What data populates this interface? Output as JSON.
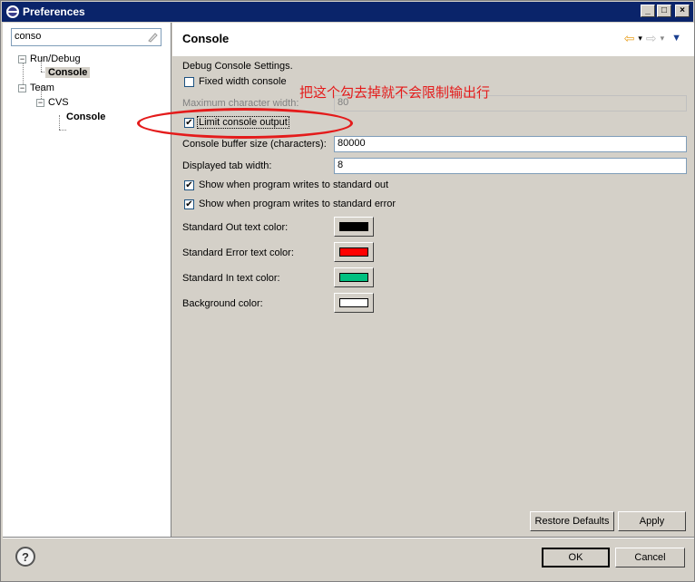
{
  "window": {
    "title": "Preferences",
    "min_label": "_",
    "max_label": "□",
    "close_label": "×"
  },
  "filter": {
    "value": "conso"
  },
  "tree": {
    "run_debug": "Run/Debug",
    "rd_console": "Console",
    "team": "Team",
    "cvs": "CVS",
    "cvs_console": "Console",
    "expanded_glyph": "−"
  },
  "page": {
    "title": "Console",
    "back_arrow": "⇦",
    "forward_arrow": "⇨",
    "dropdown_glyph": "▾",
    "menu_glyph": "▼"
  },
  "settings": {
    "heading": "Debug Console Settings.",
    "fixed_width": {
      "label": "Fixed width console",
      "checked": false
    },
    "max_char_width": {
      "label": "Maximum character width:",
      "value": "80"
    },
    "limit_output": {
      "label": "Limit console output",
      "checked": true
    },
    "buffer_size": {
      "label": "Console buffer size (characters):",
      "value": "80000"
    },
    "tab_width": {
      "label": "Displayed tab width:",
      "value": "8"
    },
    "show_out": {
      "label": "Show when program writes to standard out",
      "checked": true
    },
    "show_err": {
      "label": "Show when program writes to standard error",
      "checked": true
    },
    "out_color": {
      "label": "Standard Out text color:",
      "color": "#000000"
    },
    "err_color": {
      "label": "Standard Error text color:",
      "color": "#ff0000"
    },
    "in_color": {
      "label": "Standard In text color:",
      "color": "#00c080"
    },
    "bg_color": {
      "label": "Background color:",
      "color": "#ffffff"
    },
    "check_glyph": "✔"
  },
  "buttons": {
    "restore": "Restore Defaults",
    "apply": "Apply",
    "ok": "OK",
    "cancel": "Cancel",
    "help": "?"
  },
  "annotation": {
    "text": "把这个勾去掉就不会限制输出行",
    "color": "#e41b1b"
  }
}
